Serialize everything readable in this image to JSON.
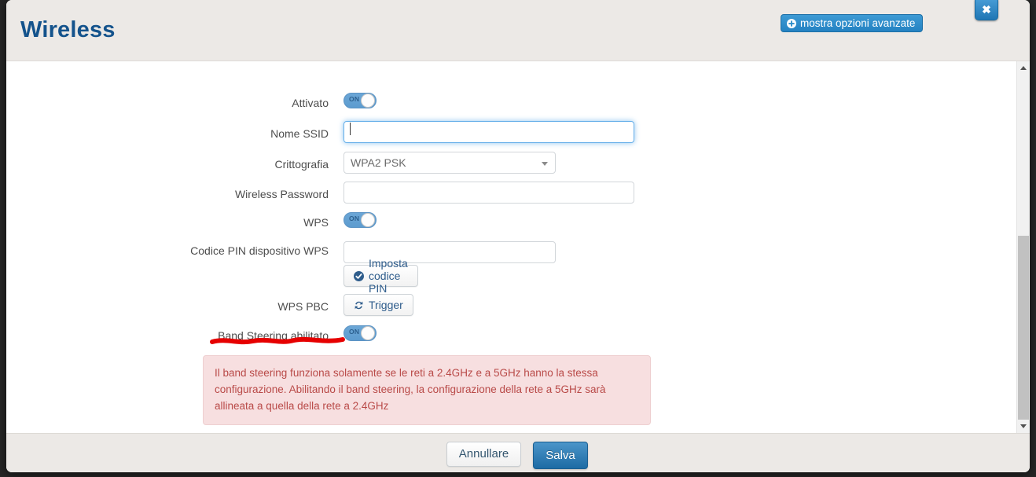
{
  "header": {
    "title": "Wireless",
    "advanced_button_label": "mostra opzioni avanzate",
    "advanced_button_icon": "plus-circle-icon",
    "close_icon": "close-icon",
    "close_glyph": "✖",
    "accent_blue": "#2a8cc9",
    "title_color": "#14538c",
    "header_bg": "#ece9e6"
  },
  "form": {
    "rows": [
      {
        "label": "Attivato",
        "control": "toggle",
        "value": "ON"
      },
      {
        "label": "Nome SSID",
        "control": "input",
        "value": "",
        "placeholder": "",
        "focused": true
      },
      {
        "label": "Crittografia",
        "control": "select",
        "value": "WPA2 PSK"
      },
      {
        "label": "Wireless Password",
        "control": "input",
        "value": "",
        "placeholder": ""
      },
      {
        "label": "WPS",
        "control": "toggle",
        "value": "ON"
      },
      {
        "label": "Codice PIN dispositivo WPS",
        "control": "input+button",
        "value": "",
        "placeholder": "",
        "button_label": "Imposta codice PIN",
        "button_icon": "check-circle-icon"
      },
      {
        "label": "WPS PBC",
        "control": "button",
        "button_label": "Trigger",
        "button_icon": "refresh-icon"
      },
      {
        "label": "Band Steering abilitato",
        "control": "toggle",
        "value": "ON",
        "annotated": true
      }
    ],
    "toggle_on_text": "ON",
    "select_options": [
      "WPA2 PSK"
    ]
  },
  "warning": {
    "text": "Il band steering funziona solamente se le reti a 2.4GHz e a 5GHz hanno la stessa configurazione. Abilitando il band steering, la configurazione della rete a 5GHz sarà allineata a quella della rete a 2.4GHz",
    "text_color": "#b94a48",
    "bg_color": "#f7dfe0"
  },
  "annotation": {
    "type": "red-underline",
    "color": "#e60000",
    "targets": "Band Steering abilitato"
  },
  "scrollbar": {
    "up_icon": "scroll-up-arrow-icon",
    "down_icon": "scroll-down-arrow-icon",
    "thumb_color": "#c1c1c1"
  },
  "footer": {
    "cancel_label": "Annullare",
    "save_label": "Salva",
    "save_color": "#1d6ba4"
  }
}
